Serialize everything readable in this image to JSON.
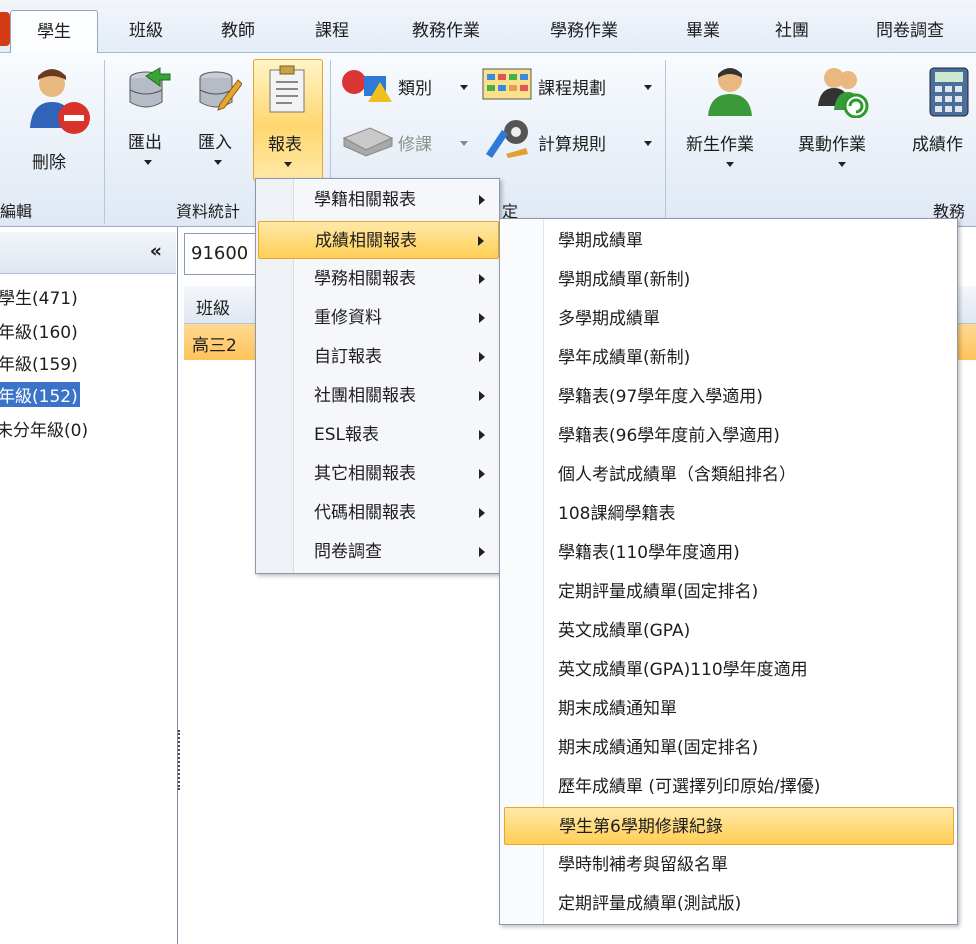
{
  "tabs": [
    "學生",
    "班級",
    "教師",
    "課程",
    "教務作業",
    "學務作業",
    "畢業",
    "社團",
    "問卷調查"
  ],
  "ribbon": {
    "delete_label": "刪除",
    "edit_group": "編輯",
    "export_label": "匯出",
    "import_label": "匯入",
    "report_label": "報表",
    "stats_group": "資料統計",
    "category_label": "類別",
    "course_plan_label": "課程規劃",
    "enroll_label": "修課",
    "calc_rule_label": "計算規則",
    "new_student_label": "新生作業",
    "transfer_label": "異動作業",
    "grade_label": "成績作",
    "setting_group_frag": "定",
    "academic_group": "教務"
  },
  "left_panel": {
    "collapse": "«",
    "items": [
      "學生(471)",
      "年級(160)",
      "年級(159)",
      "年級(152)",
      "未分年級(0)"
    ]
  },
  "main": {
    "search_value": "91600",
    "column_header": "班級",
    "row_value": "高三2"
  },
  "menu1": [
    "學籍相關報表",
    "成績相關報表",
    "學務相關報表",
    "重修資料",
    "自訂報表",
    "社團相關報表",
    "ESL報表",
    "其它相關報表",
    "代碼相關報表",
    "問卷調查"
  ],
  "menu2": [
    "學期成績單",
    "學期成績單(新制)",
    "多學期成績單",
    "學年成績單(新制)",
    "學籍表(97學年度入學適用)",
    "學籍表(96學年度前入學適用)",
    "個人考試成績單（含類組排名）",
    "108課綱學籍表",
    "學籍表(110學年度適用)",
    "定期評量成績單(固定排名)",
    "英文成績單(GPA)",
    "英文成績單(GPA)110學年度適用",
    "期末成績通知單",
    "期末成績通知單(固定排名)",
    "歷年成績單 (可選擇列印原始/擇優)",
    "學生第6學期修課紀錄",
    "學時制補考與留級名單",
    "定期評量成績單(測試版)"
  ]
}
